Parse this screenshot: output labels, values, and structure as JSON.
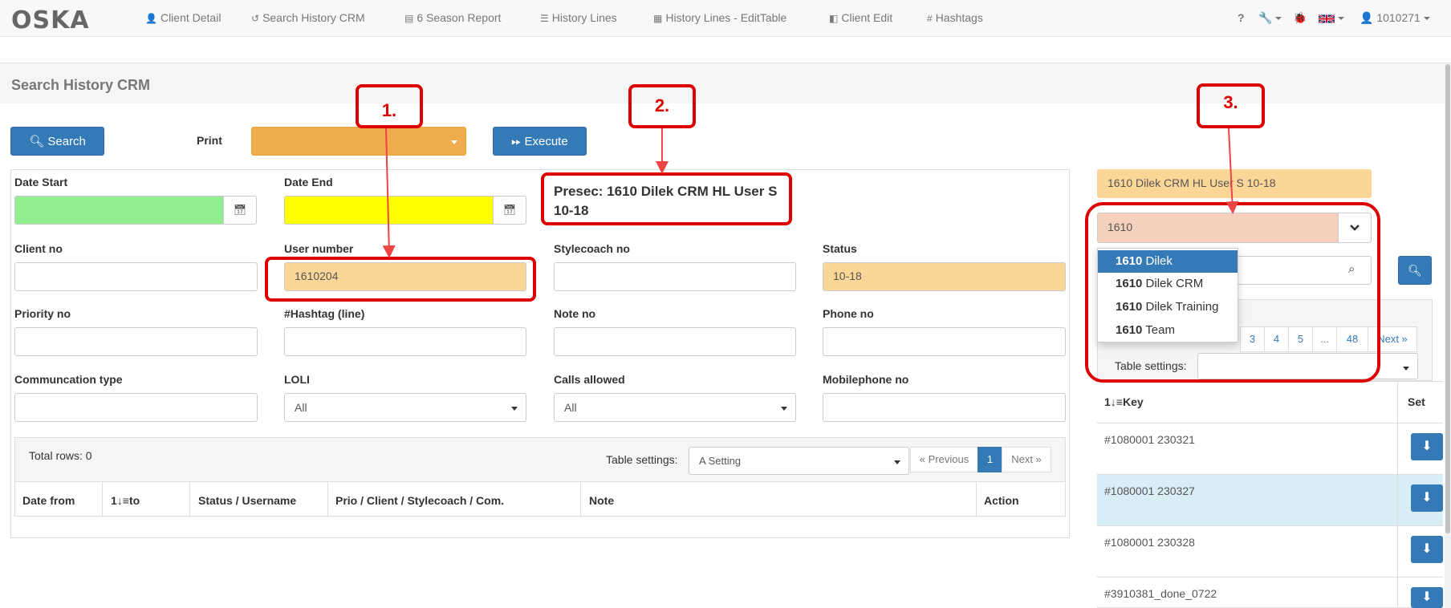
{
  "navbar": {
    "brand": "OSKA",
    "items": [
      {
        "icon": "user-icon",
        "glyph": "👤",
        "label": "Client Detail"
      },
      {
        "icon": "history-icon",
        "glyph": "↺",
        "label": "Search History CRM"
      },
      {
        "icon": "report-icon",
        "glyph": "▤",
        "label": "6 Season Report"
      },
      {
        "icon": "list-icon",
        "glyph": "☰",
        "label": "History Lines"
      },
      {
        "icon": "table-icon",
        "glyph": "▦",
        "label": "History Lines - EditTable"
      },
      {
        "icon": "edit-icon",
        "glyph": "◧",
        "label": "Client Edit"
      },
      {
        "icon": "hash-icon",
        "glyph": "#",
        "label": "Hashtags"
      }
    ],
    "help": "?",
    "user": "1010271"
  },
  "page": {
    "title": "Search History CRM"
  },
  "toolbar": {
    "search_label": "Search",
    "print_label": "Print",
    "print_value": "",
    "execute_label": "Execute"
  },
  "form": {
    "date_start": {
      "label": "Date Start",
      "value": "",
      "color": "#90ee90"
    },
    "date_end": {
      "label": "Date End",
      "value": "",
      "color": "#ffff00"
    },
    "presec": "Presec: 1610 Dilek CRM HL User S 10-18",
    "client_no": {
      "label": "Client no",
      "value": ""
    },
    "user_number": {
      "label": "User number",
      "value": "1610204",
      "color": "#fbd697"
    },
    "stylecoach_no": {
      "label": "Stylecoach no",
      "value": ""
    },
    "status": {
      "label": "Status",
      "value": "10-18",
      "color": "#fbd697"
    },
    "priority_no": {
      "label": "Priority no",
      "value": ""
    },
    "hashtag_line": {
      "label": "#Hashtag (line)",
      "value": ""
    },
    "note_no": {
      "label": "Note no",
      "value": ""
    },
    "phone_no": {
      "label": "Phone no",
      "value": ""
    },
    "communication_type": {
      "label": "Communcation type",
      "value": ""
    },
    "loli": {
      "label": "LOLI",
      "value": "All"
    },
    "calls_allowed": {
      "label": "Calls allowed",
      "value": "All"
    },
    "mobilephone_no": {
      "label": "Mobilephone no",
      "value": ""
    }
  },
  "results": {
    "total_rows": "Total rows: 0",
    "table_settings_label": "Table settings:",
    "table_settings_value": "A Setting",
    "prev": "« Previous",
    "page": "1",
    "next": "Next »",
    "columns": [
      "Date from",
      "1↓≡to",
      "Status / Username",
      "Prio / Client / Stylecoach / Com.",
      "Note",
      "Action"
    ]
  },
  "right_panel": {
    "preset_name": "1610 Dilek CRM HL User S 10-18",
    "preset_search": "1610",
    "dropdown": [
      {
        "bold": "1610",
        "rest": " Dilek"
      },
      {
        "bold": "1610",
        "rest": " Dilek CRM"
      },
      {
        "bold": "1610",
        "rest": " Dilek Training"
      },
      {
        "bold": "1610",
        "rest": " Team"
      }
    ],
    "pager": [
      "3",
      "4",
      "5",
      "...",
      "48",
      "Next »"
    ],
    "table_settings_label": "Table settings:",
    "columns": [
      "1↓≡Key",
      "Set"
    ],
    "rows": [
      "#1080001 230321",
      "#1080001 230327",
      "#1080001 230328",
      "#3910381_done_0722"
    ]
  },
  "annotations": [
    "1.",
    "2.",
    "3."
  ]
}
